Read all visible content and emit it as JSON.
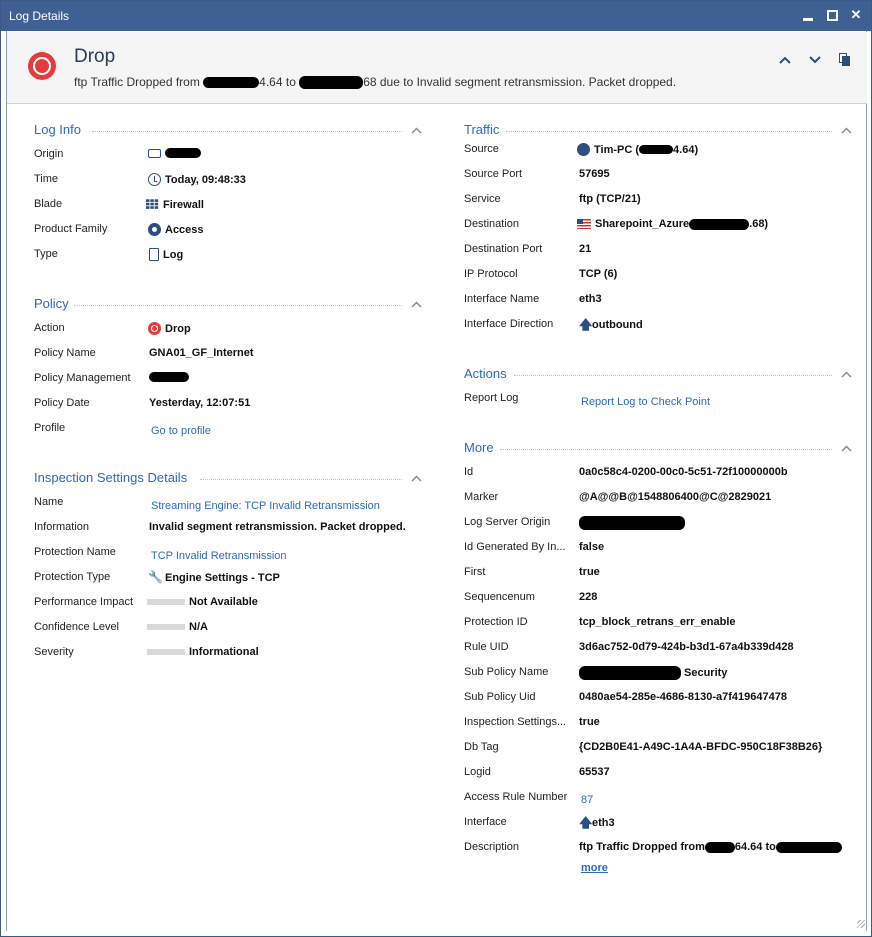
{
  "window": {
    "title": "Log Details",
    "controls": {
      "minimize": "_",
      "maximize": "□",
      "close": "✕"
    }
  },
  "header": {
    "title": "Drop",
    "desc_prefix": "ftp Traffic Dropped from ",
    "desc_src_tail": "4.64 to ",
    "desc_dst_tail": "68 due to Invalid segment retransmission. Packet dropped.",
    "icon": "drop-icon"
  },
  "log_info": {
    "title": "Log Info",
    "rows": [
      {
        "label": "Origin",
        "value": "",
        "icon": "origin-icon"
      },
      {
        "label": "Time",
        "value": "Today, 09:48:33",
        "icon": "clock-icon"
      },
      {
        "label": "Blade",
        "value": "Firewall",
        "icon": "firewall-icon"
      },
      {
        "label": "Product Family",
        "value": "Access",
        "icon": "access-icon"
      },
      {
        "label": "Type",
        "value": "Log",
        "icon": "log-icon"
      }
    ]
  },
  "policy": {
    "title": "Policy",
    "rows": [
      {
        "label": "Action",
        "value": "Drop",
        "icon": "drop-icon"
      },
      {
        "label": "Policy Name",
        "value": "GNA01_GF_Internet"
      },
      {
        "label": "Policy Management",
        "value": ""
      },
      {
        "label": "Policy Date",
        "value": "Yesterday, 12:07:51"
      },
      {
        "label": "Profile",
        "value": "Go to profile"
      }
    ]
  },
  "inspection": {
    "title": "Inspection Settings Details",
    "rows": [
      {
        "label": "Name",
        "value": "Streaming Engine: TCP Invalid Retransmission"
      },
      {
        "label": "Information",
        "value": "Invalid segment retransmission. Packet dropped."
      },
      {
        "label": "Protection Name",
        "value": "TCP Invalid Retransmission"
      },
      {
        "label": "Protection Type",
        "value": "Engine Settings - TCP",
        "icon": "wrench-icon"
      },
      {
        "label": "Performance Impact",
        "value": "Not Available"
      },
      {
        "label": "Confidence Level",
        "value": "N/A"
      },
      {
        "label": "Severity",
        "value": "Informational"
      }
    ]
  },
  "traffic": {
    "title": "Traffic",
    "rows": [
      {
        "label": "Source",
        "value": "Tim-PC (",
        "value_tail": "4.64)",
        "icon": "globe-icon"
      },
      {
        "label": "Source Port",
        "value": "57695"
      },
      {
        "label": "Service",
        "value": "ftp (TCP/21)"
      },
      {
        "label": "Destination",
        "value": "Sharepoint_Azure ",
        "value_tail": ".68)",
        "icon": "flag-icon"
      },
      {
        "label": "Destination Port",
        "value": "21"
      },
      {
        "label": "IP Protocol",
        "value": "TCP (6)"
      },
      {
        "label": "Interface Name",
        "value": "eth3"
      },
      {
        "label": "Interface Direction",
        "value": "outbound",
        "icon": "up-arrow-icon"
      }
    ]
  },
  "actions": {
    "title": "Actions",
    "rows": [
      {
        "label": "Report Log",
        "value": "Report Log to Check Point"
      }
    ]
  },
  "more": {
    "title": "More",
    "rows": [
      {
        "label": "Id",
        "value": "0a0c58c4-0200-00c0-5c51-72f10000000b"
      },
      {
        "label": "Marker",
        "value": "@A@@B@1548806400@C@2829021"
      },
      {
        "label": "Log Server Origin",
        "value": ""
      },
      {
        "label": "Id Generated By In...",
        "value": "false"
      },
      {
        "label": "First",
        "value": "true"
      },
      {
        "label": "Sequencenum",
        "value": "228"
      },
      {
        "label": "Protection ID",
        "value": "tcp_block_retrans_err_enable"
      },
      {
        "label": "Rule UID",
        "value": "3d6ac752-0d79-424b-b3d1-67a4b339d428"
      },
      {
        "label": "Sub Policy Name",
        "value": "Security"
      },
      {
        "label": "Sub Policy Uid",
        "value": "0480ae54-285e-4686-8130-a7f419647478"
      },
      {
        "label": "Inspection Settings...",
        "value": "true"
      },
      {
        "label": "Db Tag",
        "value": "{CD2B0E41-A49C-1A4A-BFDC-950C18F38B26}"
      },
      {
        "label": "Logid",
        "value": "65537"
      },
      {
        "label": "Access Rule Number",
        "value": "87"
      },
      {
        "label": "Interface",
        "value": "eth3",
        "icon": "up-arrow-icon"
      },
      {
        "label": "Description",
        "value": "ftp Traffic Dropped from ",
        "value_tail": "64.64 to ",
        "more_link": "more"
      }
    ]
  }
}
